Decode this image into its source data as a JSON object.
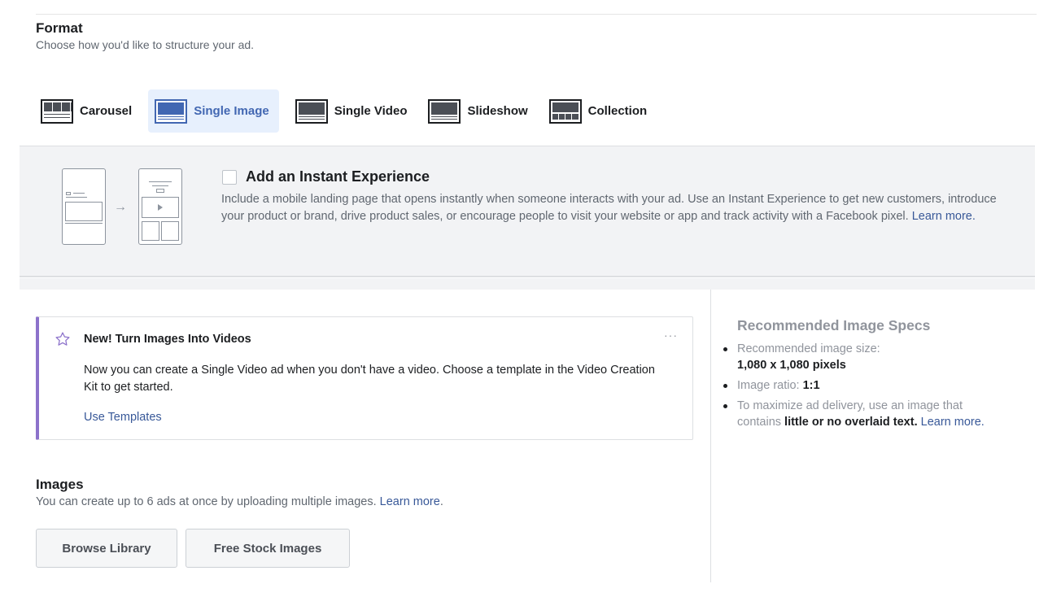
{
  "format": {
    "title": "Format",
    "subtitle": "Choose how you'd like to structure your ad."
  },
  "tabs": [
    {
      "label": "Carousel",
      "icon": "carousel-icon",
      "active": false
    },
    {
      "label": "Single Image",
      "icon": "single-image-icon",
      "active": true
    },
    {
      "label": "Single Video",
      "icon": "single-video-icon",
      "active": false
    },
    {
      "label": "Slideshow",
      "icon": "slideshow-icon",
      "active": false
    },
    {
      "label": "Collection",
      "icon": "collection-icon",
      "active": false
    }
  ],
  "instant_experience": {
    "title": "Add an Instant Experience",
    "checked": false,
    "description": "Include a mobile landing page that opens instantly when someone interacts with your ad. Use an Instant Experience to get new customers, introduce your product or brand, drive product sales, or encourage people to visit your website or app and track activity with a Facebook pixel.",
    "link": "Learn more.",
    "arrow": "→"
  },
  "promo": {
    "title": "New! Turn Images Into Videos",
    "more": "···",
    "body": "Now you can create a Single Video ad when you don't have a video. Choose a template in the Video Creation Kit to get started.",
    "link": "Use Templates",
    "accent_color": "#8c72cb"
  },
  "images": {
    "title": "Images",
    "subtitle": "You can create up to 6 ads at once by uploading multiple images.",
    "link": "Learn more",
    "period": ".",
    "buttons": [
      "Browse Library",
      "Free Stock Images"
    ]
  },
  "specs": {
    "title": "Recommended Image Specs",
    "size_label": "Recommended image size:",
    "size_value": "1,080 x 1,080 pixels",
    "ratio_label": "Image ratio: ",
    "ratio_value": "1:1",
    "delivery_text": "To maximize ad delivery, use an image that contains ",
    "delivery_bold": "little or no overlaid text.",
    "delivery_link": "Learn more."
  },
  "colors": {
    "accent": "#4267b2",
    "link": "#385898",
    "active_tab_bg": "#e7f0fd"
  }
}
